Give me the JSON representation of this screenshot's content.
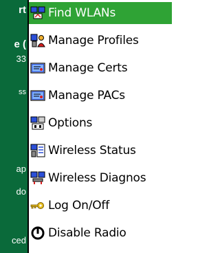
{
  "background": {
    "fragments": [
      "rt",
      "e (",
      "33",
      "ss",
      "",
      "ap",
      "do",
      "",
      "ced"
    ]
  },
  "menu": {
    "items": [
      {
        "label": "Find WLANs",
        "icon": "find-wlans-icon",
        "selected": true
      },
      {
        "label": "Manage Profiles",
        "icon": "manage-profiles-icon",
        "selected": false
      },
      {
        "label": "Manage Certs",
        "icon": "manage-certs-icon",
        "selected": false
      },
      {
        "label": "Manage PACs",
        "icon": "manage-pacs-icon",
        "selected": false
      },
      {
        "label": "Options",
        "icon": "options-icon",
        "selected": false
      },
      {
        "label": "Wireless Status",
        "icon": "wireless-status-icon",
        "selected": false
      },
      {
        "label": "Wireless Diagnos",
        "icon": "wireless-diagnostics-icon",
        "selected": false
      },
      {
        "label": "Log On/Off",
        "icon": "key-icon",
        "selected": false
      },
      {
        "label": "Disable Radio",
        "icon": "power-icon",
        "selected": false
      }
    ]
  },
  "colors": {
    "selected_bg": "#2fa335",
    "background_strip": "#0a6a3a"
  }
}
